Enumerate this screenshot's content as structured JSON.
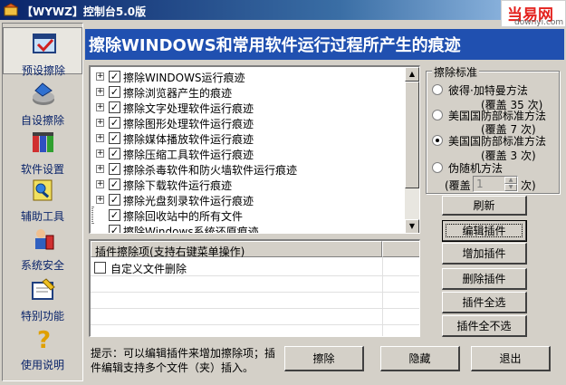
{
  "window": {
    "title": "【WYWZ】控制台5.0版"
  },
  "watermark": {
    "line1": "当易网",
    "line2": "downyi.com"
  },
  "sidebar": {
    "items": [
      {
        "label": "预设擦除",
        "icon": "preset-clean-icon"
      },
      {
        "label": "自设擦除",
        "icon": "custom-clean-icon"
      },
      {
        "label": "软件设置",
        "icon": "settings-icon"
      },
      {
        "label": "辅助工具",
        "icon": "tools-icon"
      },
      {
        "label": "系统安全",
        "icon": "security-icon"
      },
      {
        "label": "特别功能",
        "icon": "special-icon"
      },
      {
        "label": "使用说明",
        "icon": "help-icon"
      }
    ]
  },
  "header": {
    "title": "擦除WINDOWS和常用软件运行过程所产生的痕迹"
  },
  "tree": {
    "items": [
      {
        "label": "擦除WINDOWS运行痕迹",
        "expandable": true,
        "checked": true
      },
      {
        "label": "擦除浏览器产生的痕迹",
        "expandable": true,
        "checked": true
      },
      {
        "label": "擦除文字处理软件运行痕迹",
        "expandable": true,
        "checked": true
      },
      {
        "label": "擦除图形处理软件运行痕迹",
        "expandable": true,
        "checked": true
      },
      {
        "label": "擦除媒体播放软件运行痕迹",
        "expandable": true,
        "checked": true
      },
      {
        "label": "擦除压缩工具软件运行痕迹",
        "expandable": true,
        "checked": true
      },
      {
        "label": "擦除杀毒软件和防火墙软件运行痕迹",
        "expandable": true,
        "checked": true
      },
      {
        "label": "擦除下载软件运行痕迹",
        "expandable": true,
        "checked": true
      },
      {
        "label": "擦除光盘刻录软件运行痕迹",
        "expandable": true,
        "checked": true
      },
      {
        "label": "擦除回收站中的所有文件",
        "expandable": false,
        "checked": true
      },
      {
        "label": "擦除Windows系统还原痕迹",
        "expandable": false,
        "checked": true
      }
    ]
  },
  "plugins": {
    "header": "插件擦除项(支持右键菜单操作)",
    "items": [
      {
        "label": "自定义文件删除",
        "checked": false
      }
    ]
  },
  "standard": {
    "legend": "擦除标准",
    "options": [
      {
        "label": "彼得·加特曼方法",
        "sub": "(覆盖 35 次)",
        "selected": false
      },
      {
        "label": "美国国防部标准方法",
        "sub": "(覆盖 7 次)",
        "selected": false
      },
      {
        "label": "美国国防部标准方法",
        "sub": "(覆盖 3 次)",
        "selected": true
      },
      {
        "label": "伪随机方法",
        "sub": "",
        "selected": false
      }
    ],
    "cover_prefix": "(覆盖",
    "cover_value": "1",
    "cover_suffix": "次)"
  },
  "buttons": {
    "refresh": "刷新",
    "edit_plugin": "编辑插件",
    "add_plugin": "增加插件",
    "delete_plugin": "删除插件",
    "select_all": "插件全选",
    "select_none": "插件全不选",
    "erase": "擦除",
    "hide": "隐藏",
    "exit": "退出"
  },
  "hint": "提示：可以编辑插件来增加擦除项；插件编辑支持多个文件（夹）插入。"
}
